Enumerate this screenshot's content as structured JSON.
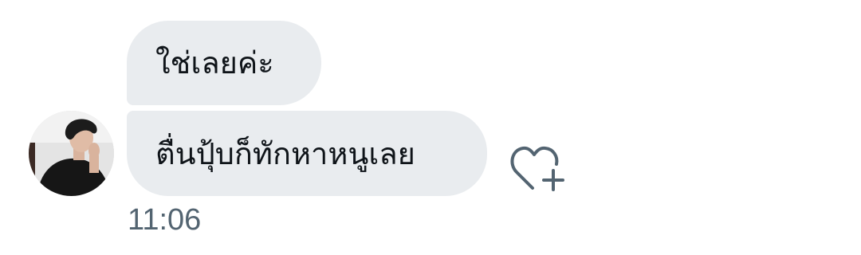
{
  "conversation": {
    "messages": [
      {
        "text": "ใช่เลยค่ะ"
      },
      {
        "text": "ตื่นปุ้บก็ทักหาหนูเลย"
      }
    ],
    "timestamp": "11:06"
  },
  "icons": {
    "react": "heart-plus-icon",
    "avatar": "user-avatar-photo"
  },
  "colors": {
    "bubble": "#e9ecef",
    "text": "#0f1419",
    "timestamp": "#536471",
    "icon": "#536471"
  }
}
